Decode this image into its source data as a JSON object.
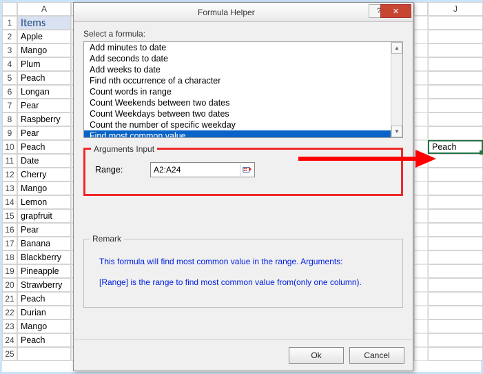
{
  "columns": [
    "A",
    "",
    "",
    "J"
  ],
  "items_header": "Items",
  "items": [
    "Apple",
    "Mango",
    "Plum",
    "Peach",
    "Longan",
    "Pear",
    "Raspberry",
    "Pear",
    "Peach",
    "Date",
    "Cherry",
    "Mango",
    "Lemon",
    "grapfruit",
    "Pear",
    "Banana",
    "Blackberry",
    "Pineapple",
    "Strawberry",
    "Peach",
    "Durian",
    "Mango",
    "Peach",
    ""
  ],
  "result_cell": {
    "row": 10,
    "col": "J",
    "value": "Peach"
  },
  "dialog": {
    "title": "Formula Helper",
    "help_label": "?",
    "close_label": "✕",
    "select_formula_label": "Select a formula:",
    "formulas": [
      "Add minutes to date",
      "Add seconds to date",
      "Add weeks to date",
      "Find nth occurrence of a character",
      "Count words in range",
      "Count Weekends between two dates",
      "Count Weekdays between two dates",
      "Count the number of specific weekday",
      "Find most common value"
    ],
    "formulas_selected_index": 8,
    "args_label": "Arguments Input",
    "range_label": "Range:",
    "range_value": "A2:A24",
    "remark_label": "Remark",
    "remark_text1": "This formula will find most common value in the range. Arguments:",
    "remark_text2": "[Range] is the range to find most common value from(only one column).",
    "ok_label": "Ok",
    "cancel_label": "Cancel"
  }
}
